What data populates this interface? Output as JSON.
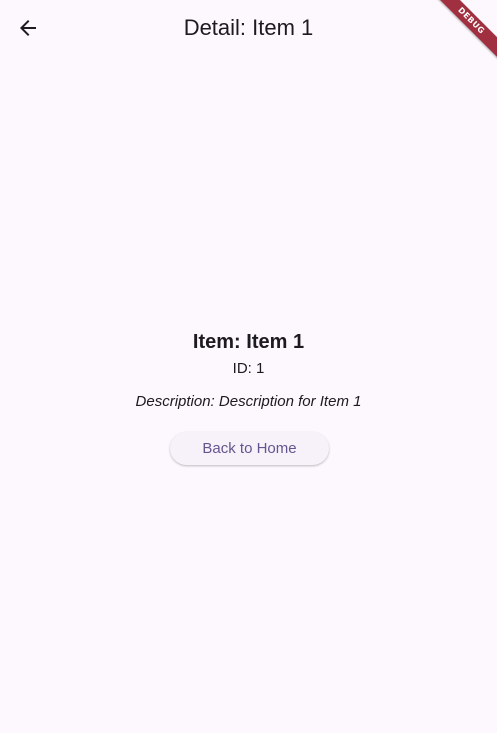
{
  "app_bar": {
    "title": "Detail: Item 1",
    "back_icon": "arrow-back-icon"
  },
  "debug_banner": {
    "label": "DEBUG",
    "color": "#a0303f"
  },
  "detail": {
    "title": "Item: Item 1",
    "id_text": "ID: 1",
    "description_text": "Description: Description for Item 1"
  },
  "actions": {
    "back_home_label": "Back to Home"
  },
  "colors": {
    "background": "#fdf7fe",
    "text": "#1d1b20",
    "button_text": "#65558f",
    "button_bg": "#f7f2fa"
  }
}
